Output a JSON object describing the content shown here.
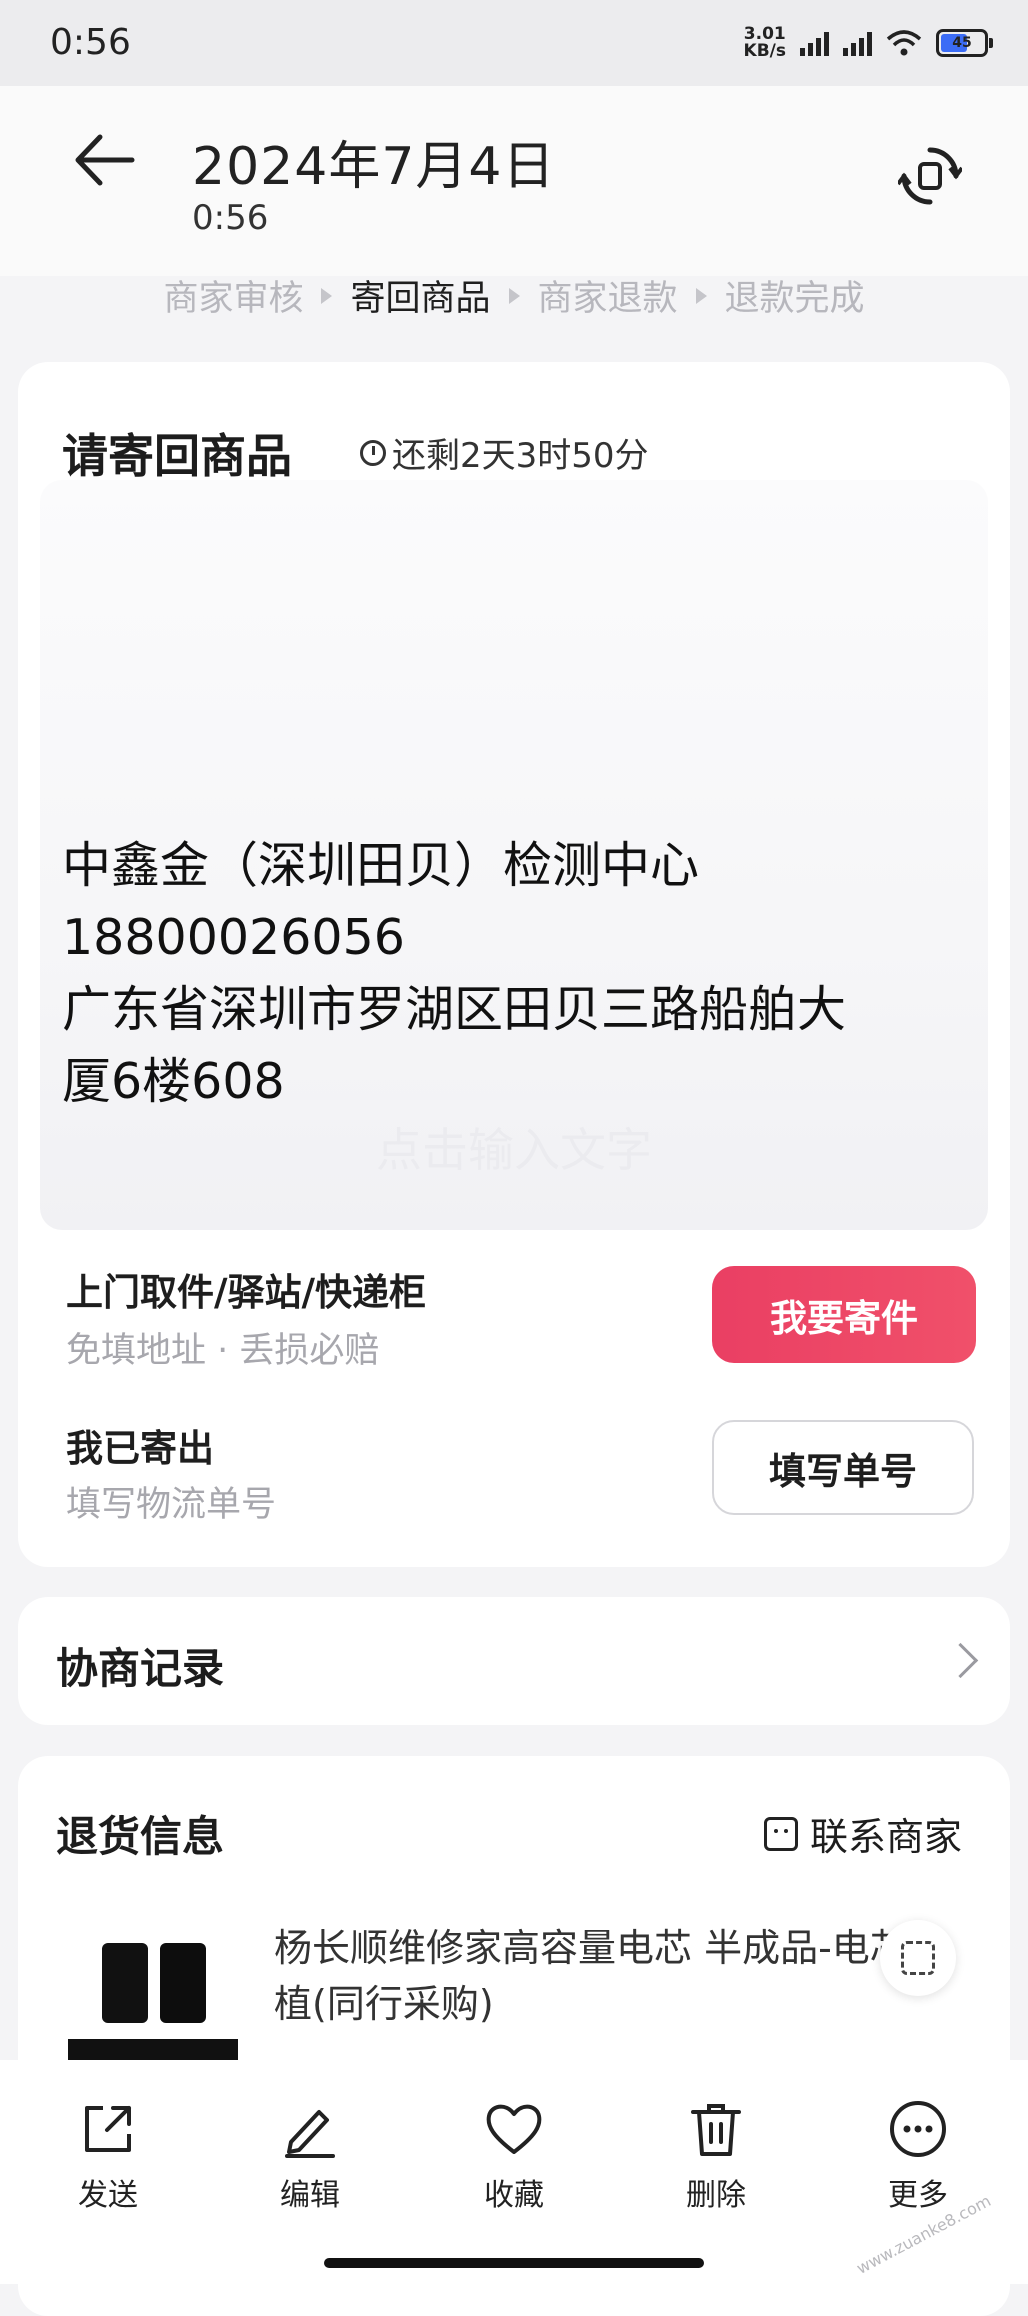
{
  "status_bar": {
    "time": "0:56",
    "net_speed_value": "3.01",
    "net_speed_unit": "KB/s",
    "battery": "45"
  },
  "header": {
    "title": "2024年7月4日",
    "subtitle": "0:56"
  },
  "steps": [
    "商家审核",
    "寄回商品",
    "商家退款",
    "退款完成"
  ],
  "send_back": {
    "title": "请寄回商品",
    "countdown": "还剩2天3时50分",
    "address": {
      "name": "中鑫金（深圳田贝）检测中心",
      "phone": "18800026056",
      "line1": "广东省深圳市罗湖区田贝三路船舶大",
      "line2": "厦6楼608"
    },
    "hint": "点击输入文字",
    "pickup_title": "上门取件/驿站/快递柜",
    "pickup_sub": "免填地址 · 丢损必赔",
    "pickup_button": "我要寄件",
    "sent_title": "我已寄出",
    "sent_sub": "填写物流单号",
    "sent_button": "填写单号"
  },
  "negotiation": {
    "title": "协商记录"
  },
  "return_info": {
    "title": "退货信息",
    "contact": "联系商家",
    "product_name": "杨长顺维修家高容量电芯 半成品-电芯移植(同行采购)"
  },
  "toolbar": {
    "items": [
      {
        "label": "发送",
        "icon": "share-icon"
      },
      {
        "label": "编辑",
        "icon": "edit-icon"
      },
      {
        "label": "收藏",
        "icon": "heart-icon"
      },
      {
        "label": "删除",
        "icon": "trash-icon"
      },
      {
        "label": "更多",
        "icon": "more-icon"
      }
    ]
  },
  "watermark": "www.zuanke8.com",
  "colors": {
    "accent": "#ea3f63",
    "muted": "#b7b7bd"
  }
}
